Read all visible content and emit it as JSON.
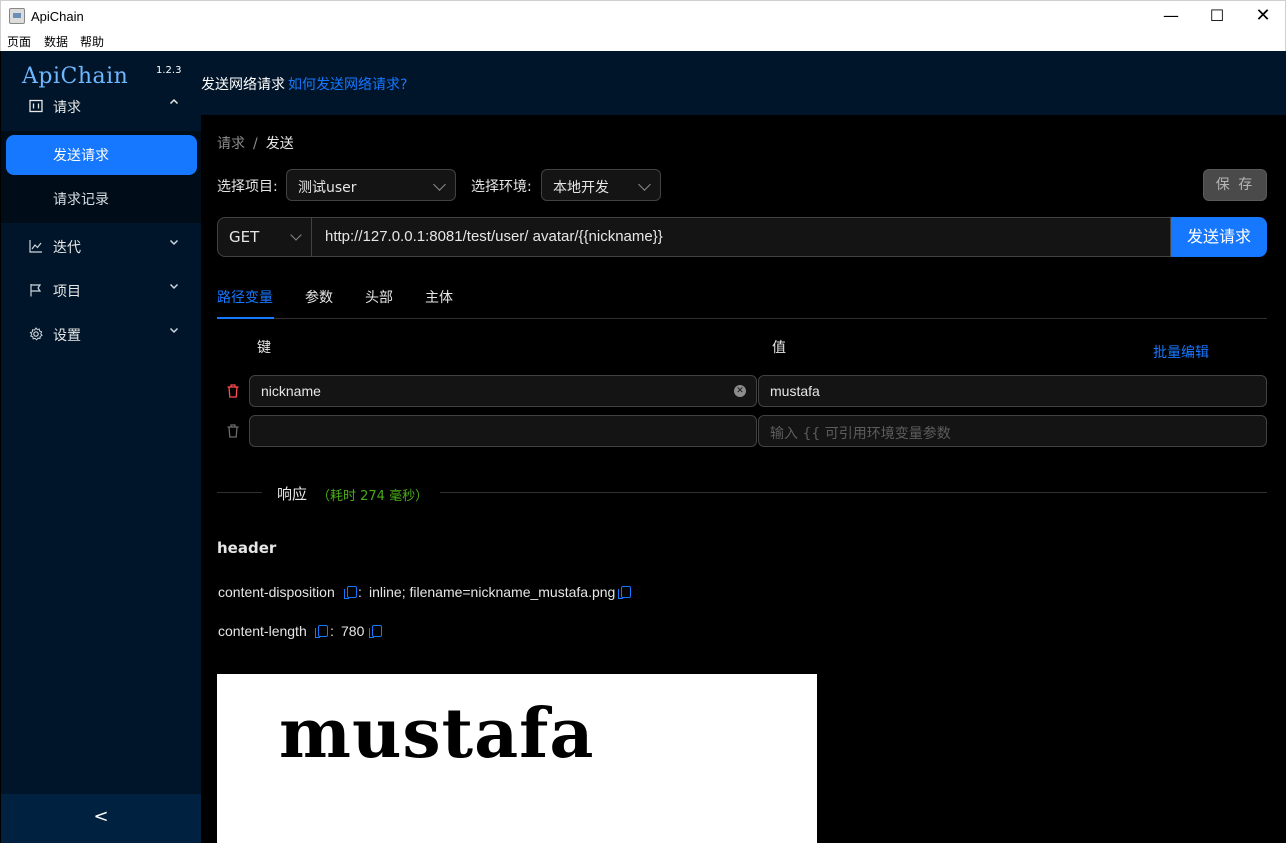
{
  "window": {
    "title": "ApiChain",
    "menus": [
      "页面",
      "数据",
      "帮助"
    ],
    "minimize_glyph": "—",
    "maximize_glyph": "☐",
    "close_glyph": "✕"
  },
  "sidebar": {
    "logo": "ApiChain",
    "version": "1.2.3",
    "groups": [
      {
        "label": "请求",
        "icon": "request-icon",
        "expanded": true
      },
      {
        "label": "迭代",
        "icon": "iteration-chart-icon",
        "expanded": false
      },
      {
        "label": "项目",
        "icon": "project-flag-icon",
        "expanded": false
      },
      {
        "label": "设置",
        "icon": "settings-gear-icon",
        "expanded": false
      }
    ],
    "sub_items": [
      {
        "label": "发送请求",
        "active": true
      },
      {
        "label": "请求记录",
        "active": false
      }
    ],
    "collapse_glyph": "<"
  },
  "header": {
    "title": "发送网络请求",
    "help_link": "如何发送网络请求?"
  },
  "breadcrumb": {
    "parent": "请求",
    "separator": "/",
    "current": "发送"
  },
  "selectors": {
    "project_label": "选择项目:",
    "project_value": "测试user",
    "env_label": "选择环境:",
    "env_value": "本地开发",
    "save_label": "保 存"
  },
  "request": {
    "method": "GET",
    "url": "http://127.0.0.1:8081/test/user/ avatar/{{nickname}}",
    "send_label": "发送请求"
  },
  "tabs": [
    "路径变量",
    "参数",
    "头部",
    "主体"
  ],
  "params_table": {
    "key_header": "键",
    "value_header": "值",
    "bulk_edit": "批量编辑",
    "rows": [
      {
        "key": "nickname",
        "value": "mustafa"
      },
      {
        "key": "",
        "value_placeholder": "输入 {{ 可引用环境变量参数"
      }
    ]
  },
  "response": {
    "title": "响应",
    "time": "（耗时 274 毫秒）",
    "header_title": "header",
    "headers": [
      {
        "key": "content-disposition",
        "sep": ":",
        "value": "inline; filename=nickname_mustafa.png"
      },
      {
        "key": "content-length",
        "sep": ":",
        "value": "780"
      }
    ],
    "image_text": "mustafa"
  },
  "colors": {
    "primary": "#1677ff",
    "sidebar_bg": "#001529",
    "success": "#49aa19",
    "danger": "#ff4d4f"
  }
}
